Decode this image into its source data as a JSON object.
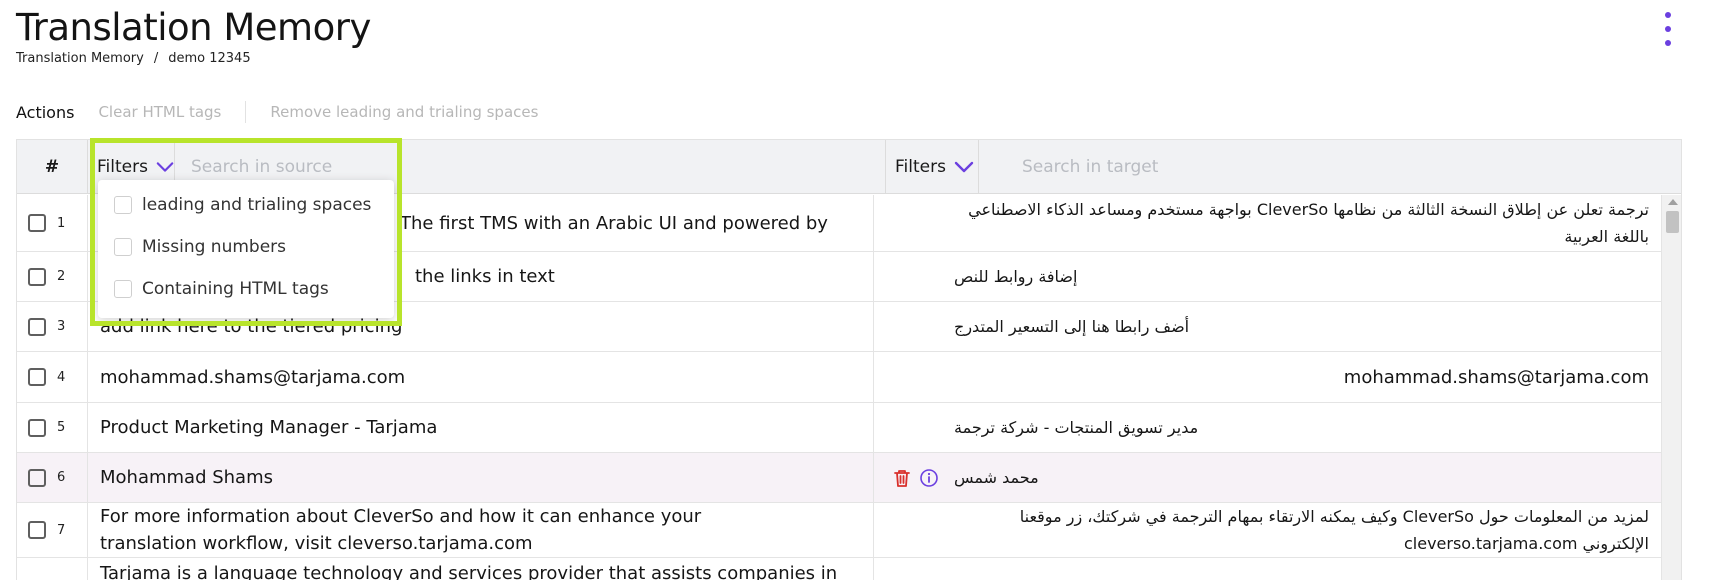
{
  "page": {
    "title": "Translation Memory",
    "breadcrumb": [
      "Translation Memory",
      "/",
      "demo 12345"
    ]
  },
  "actions": {
    "label": "Actions",
    "items": [
      "Clear HTML tags",
      "Remove leading and trialing spaces"
    ]
  },
  "table": {
    "num_header": "#",
    "source_filters_label": "Filters",
    "source_search_placeholder": "Search in source",
    "target_filters_label": "Filters",
    "target_search_placeholder": "Search in target",
    "rows": [
      {
        "num": "1",
        "source": "The first TMS with an Arabic UI and powered by",
        "target": "ترجمة تعلن عن إطلاق النسخة الثالثة من نظامها CleverSo بواجهة مستخدم ومساعد الذكاء الاصطناعي باللغة العربية"
      },
      {
        "num": "2",
        "source": "the links in text",
        "target": "إضافة روابط للنص"
      },
      {
        "num": "3",
        "source": "add link here to the tiered pricing",
        "target": "أضف رابطا هنا إلى التسعير المتدرج"
      },
      {
        "num": "4",
        "source": "mohammad.shams@tarjama.com",
        "target": "mohammad.shams@tarjama.com"
      },
      {
        "num": "5",
        "source": "Product Marketing Manager - Tarjama",
        "target": "مدير تسويق المنتجات - شركة ترجمة"
      },
      {
        "num": "6",
        "source": "Mohammad Shams",
        "target": "محمد شمس"
      },
      {
        "num": "7",
        "source": "For more information about CleverSo and how it can enhance your translation workflow, visit cleverso.tarjama.com",
        "target": "لمزيد من المعلومات حول CleverSo وكيف يمكنه الارتقاء بمهام الترجمة في شركتك، زر موقعنا الإلكتروني cleverso.tarjama.com"
      },
      {
        "num": "",
        "source": "Tarjama is a language technology and services provider that assists companies in",
        "target": ""
      }
    ]
  },
  "filters_dropdown": {
    "options": [
      "leading and trialing spaces",
      "Missing numbers",
      "Containing HTML tags"
    ]
  },
  "colors": {
    "accent": "#6b3fe0",
    "highlight": "#b8e42b",
    "delete": "#d9302c",
    "selected_row": "#f7f2f7"
  },
  "icons": {
    "kebab": "more-vertical-icon",
    "filters_chevron": "chevron-down-icon",
    "row_delete": "trash-icon",
    "row_info": "info-icon"
  }
}
